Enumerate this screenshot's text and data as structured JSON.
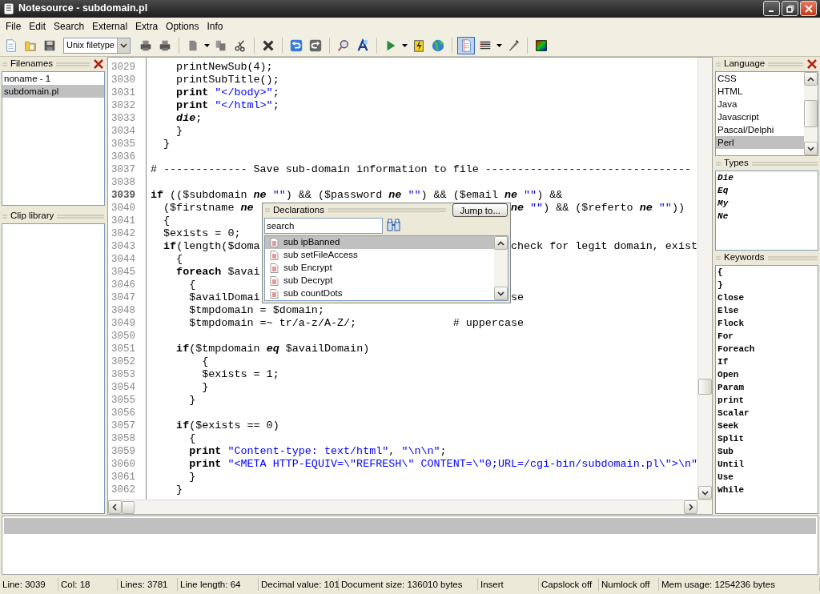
{
  "window": {
    "title": "Notesource - subdomain.pl"
  },
  "menu": [
    "File",
    "Edit",
    "Search",
    "External",
    "Extra",
    "Options",
    "Info"
  ],
  "toolbar": {
    "filetype": "Unix filetype",
    "document_view_pressed": true
  },
  "filenames": {
    "title": "Filenames",
    "items": [
      {
        "label": "noname - 1",
        "selected": false
      },
      {
        "label": "subdomain.pl",
        "selected": true
      }
    ]
  },
  "clip_library": {
    "title": "Clip library"
  },
  "editor": {
    "lines": [
      {
        "number": "3029",
        "current": false,
        "tokens": [
          {
            "kind": "plain",
            "text": "    printNewSub(4);"
          }
        ]
      },
      {
        "number": "3030",
        "current": false,
        "tokens": [
          {
            "kind": "plain",
            "text": "    printSubTitle();"
          }
        ]
      },
      {
        "number": "3031",
        "current": false,
        "tokens": [
          {
            "kind": "keyword",
            "text": "    print"
          },
          {
            "kind": "string",
            "text": " \"</body>\""
          },
          {
            "kind": "plain",
            "text": ";"
          }
        ]
      },
      {
        "number": "3032",
        "current": false,
        "tokens": [
          {
            "kind": "keyword",
            "text": "    print"
          },
          {
            "kind": "string",
            "text": " \"</html>\""
          },
          {
            "kind": "plain",
            "text": ";"
          }
        ]
      },
      {
        "number": "3033",
        "current": false,
        "tokens": [
          {
            "kind": "type",
            "text": "    die"
          },
          {
            "kind": "plain",
            "text": ";"
          }
        ]
      },
      {
        "number": "3034",
        "current": false,
        "tokens": [
          {
            "kind": "plain",
            "text": "    }"
          }
        ]
      },
      {
        "number": "3035",
        "current": false,
        "tokens": [
          {
            "kind": "plain",
            "text": "  }"
          }
        ]
      },
      {
        "number": "3036",
        "current": false
      },
      {
        "number": "3037",
        "current": false,
        "tokens": [
          {
            "kind": "plain",
            "text": "# ------------- Save sub-domain information to file --------------------------------"
          }
        ]
      },
      {
        "number": "3038",
        "current": false
      },
      {
        "number": "3039",
        "current": true,
        "tokens": [
          {
            "kind": "keyword",
            "text": "if"
          },
          {
            "kind": "plain",
            "text": " (($subdomain "
          },
          {
            "kind": "type",
            "text": "ne"
          },
          {
            "kind": "string",
            "text": " \"\""
          },
          {
            "kind": "plain",
            "text": ") && ($password "
          },
          {
            "kind": "type",
            "text": "ne"
          },
          {
            "kind": "string",
            "text": " \"\""
          },
          {
            "kind": "plain",
            "text": ") && ($email "
          },
          {
            "kind": "type",
            "text": "ne"
          },
          {
            "kind": "string",
            "text": " \"\""
          },
          {
            "kind": "plain",
            "text": ") &&"
          }
        ]
      },
      {
        "number": "3040",
        "current": false,
        "tokens": [
          {
            "kind": "plain",
            "text": "  ($firstname "
          },
          {
            "kind": "type",
            "text": "ne"
          }
        ],
        "tokens_after_popup": [
          {
            "kind": "type",
            "text": "ne"
          },
          {
            "kind": "string",
            "text": " \"\""
          },
          {
            "kind": "plain",
            "text": ") && ($referto "
          },
          {
            "kind": "type",
            "text": "ne"
          },
          {
            "kind": "string",
            "text": " \"\""
          },
          {
            "kind": "plain",
            "text": "))"
          }
        ]
      },
      {
        "number": "3041",
        "current": false,
        "tokens": [
          {
            "kind": "plain",
            "text": "  {"
          }
        ]
      },
      {
        "number": "3042",
        "current": false,
        "tokens": [
          {
            "kind": "plain",
            "text": "  $exists = 0;"
          }
        ]
      },
      {
        "number": "3043",
        "current": false,
        "tokens": [
          {
            "kind": "keyword",
            "text": "  if"
          },
          {
            "kind": "plain",
            "text": "(length($doma"
          }
        ],
        "tokens_after_popup": [
          {
            "kind": "plain",
            "text": "check for legit domain, exist"
          }
        ]
      },
      {
        "number": "3044",
        "current": false,
        "tokens": [
          {
            "kind": "plain",
            "text": "    {"
          }
        ]
      },
      {
        "number": "3045",
        "current": false,
        "tokens": [
          {
            "kind": "keyword",
            "text": "    foreach"
          },
          {
            "kind": "plain",
            "text": " $avai"
          }
        ]
      },
      {
        "number": "3046",
        "current": false,
        "tokens": [
          {
            "kind": "plain",
            "text": "      {"
          }
        ]
      },
      {
        "number": "3047",
        "current": false,
        "tokens": [
          {
            "kind": "plain",
            "text": "      $availDomai"
          }
        ],
        "tokens_after_popup": [
          {
            "kind": "plain",
            "text": "se"
          }
        ]
      },
      {
        "number": "3048",
        "current": false,
        "tokens": [
          {
            "kind": "plain",
            "text": "      $tmpdomain = $domain;"
          }
        ]
      },
      {
        "number": "3049",
        "current": false,
        "tokens": [
          {
            "kind": "plain",
            "text": "      $tmpdomain =~ tr/a-z/A-Z/;               # uppercase"
          }
        ]
      },
      {
        "number": "3050",
        "current": false
      },
      {
        "number": "3051",
        "current": false,
        "tokens": [
          {
            "kind": "keyword",
            "text": "    if"
          },
          {
            "kind": "plain",
            "text": "($tmpdomain "
          },
          {
            "kind": "type",
            "text": "eq"
          },
          {
            "kind": "plain",
            "text": " $availDomain)"
          }
        ]
      },
      {
        "number": "3052",
        "current": false,
        "tokens": [
          {
            "kind": "plain",
            "text": "        {"
          }
        ]
      },
      {
        "number": "3053",
        "current": false,
        "tokens": [
          {
            "kind": "plain",
            "text": "        $exists = 1;"
          }
        ]
      },
      {
        "number": "3054",
        "current": false,
        "tokens": [
          {
            "kind": "plain",
            "text": "        }"
          }
        ]
      },
      {
        "number": "3055",
        "current": false,
        "tokens": [
          {
            "kind": "plain",
            "text": "      }"
          }
        ]
      },
      {
        "number": "3056",
        "current": false
      },
      {
        "number": "3057",
        "current": false,
        "tokens": [
          {
            "kind": "keyword",
            "text": "    if"
          },
          {
            "kind": "plain",
            "text": "($exists == 0)"
          }
        ]
      },
      {
        "number": "3058",
        "current": false,
        "tokens": [
          {
            "kind": "plain",
            "text": "      {"
          }
        ]
      },
      {
        "number": "3059",
        "current": false,
        "tokens": [
          {
            "kind": "keyword",
            "text": "      print"
          },
          {
            "kind": "string",
            "text": " \"Content-type: text/html\""
          },
          {
            "kind": "plain",
            "text": ", "
          },
          {
            "kind": "string",
            "text": "\"\\n\\n\""
          },
          {
            "kind": "plain",
            "text": ";"
          }
        ]
      },
      {
        "number": "3060",
        "current": false,
        "tokens": [
          {
            "kind": "keyword",
            "text": "      print"
          },
          {
            "kind": "string",
            "text": " \"<META HTTP-EQUIV=\\\"REFRESH\\\" CONTENT=\\\"0;URL=/cgi-bin/subdomain.pl\\\">\\n\""
          }
        ]
      },
      {
        "number": "3061",
        "current": false,
        "tokens": [
          {
            "kind": "plain",
            "text": "      }"
          }
        ]
      },
      {
        "number": "3062",
        "current": false,
        "tokens": [
          {
            "kind": "plain",
            "text": "    }"
          }
        ]
      }
    ]
  },
  "declarations": {
    "title": "Declarations",
    "jump_button": "Jump to...",
    "search": {
      "value": "search"
    },
    "items": [
      {
        "label": "sub ipBanned",
        "selected": true
      },
      {
        "label": "sub setFileAccess",
        "selected": false
      },
      {
        "label": "sub Encrypt",
        "selected": false
      },
      {
        "label": "sub Decrypt",
        "selected": false
      },
      {
        "label": "sub countDots",
        "selected": false
      }
    ]
  },
  "language": {
    "title": "Language",
    "items": [
      {
        "label": "CSS",
        "selected": false
      },
      {
        "label": "HTML",
        "selected": false
      },
      {
        "label": "Java",
        "selected": false
      },
      {
        "label": "Javascript",
        "selected": false
      },
      {
        "label": "Pascal/Delphi",
        "selected": false
      },
      {
        "label": "Perl",
        "selected": true
      }
    ]
  },
  "types": {
    "title": "Types",
    "items": [
      "Die",
      "Eq",
      "My",
      "Ne"
    ]
  },
  "keywords": {
    "title": "Keywords",
    "items": [
      "{",
      "}",
      "Close",
      "Else",
      "Flock",
      "For",
      "Foreach",
      "If",
      "Open",
      "Param",
      "print",
      "Scalar",
      "Seek",
      "Split",
      "Sub",
      "Until",
      "Use",
      "While"
    ]
  },
  "status_bar": [
    "Line: 3039",
    "Col: 18",
    "Lines: 3781",
    "Line length: 64",
    "Decimal value: 101",
    "Document size: 136010 bytes",
    "Insert",
    "Capslock off",
    "Numlock off",
    "Mem usage: 1254236 bytes"
  ]
}
